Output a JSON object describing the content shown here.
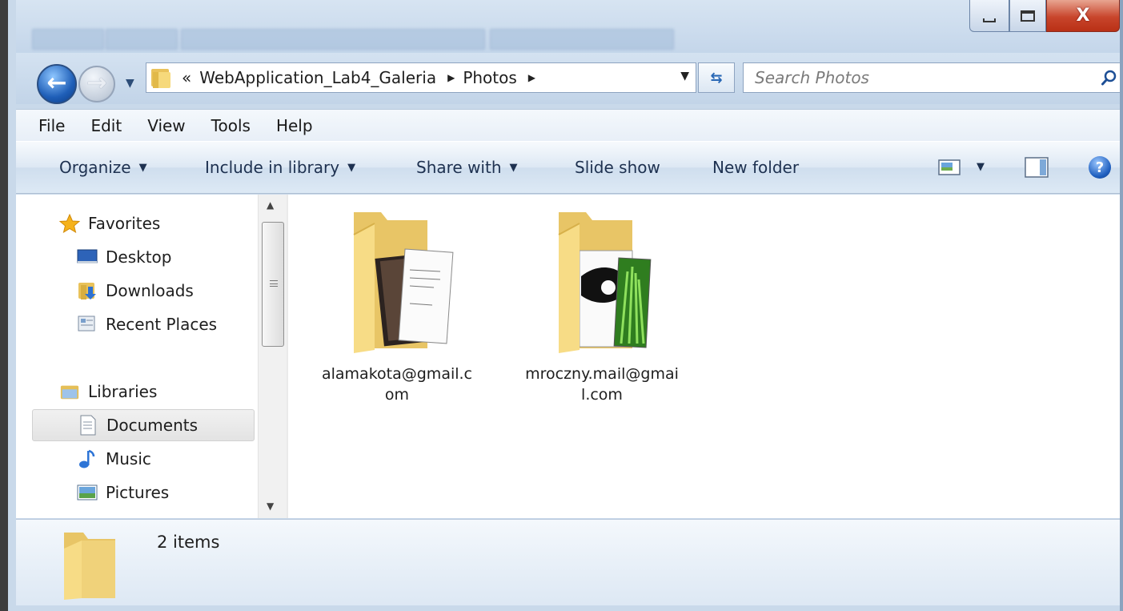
{
  "window": {
    "minimize_icon": "minimize-icon",
    "maximize_icon": "maximize-icon",
    "close_label": "X"
  },
  "nav": {
    "address_chevron": "«",
    "breadcrumbs": [
      "WebApplication_Lab4_Galeria",
      "Photos"
    ],
    "search_placeholder": "Search Photos"
  },
  "menu": [
    "File",
    "Edit",
    "View",
    "Tools",
    "Help"
  ],
  "toolbar": {
    "organize": "Organize",
    "include_in_library": "Include in library",
    "share_with": "Share with",
    "slide_show": "Slide show",
    "new_folder": "New folder",
    "help": "?"
  },
  "sidebar": {
    "favorites": {
      "label": "Favorites",
      "items": [
        "Desktop",
        "Downloads",
        "Recent Places"
      ]
    },
    "libraries": {
      "label": "Libraries",
      "items": [
        "Documents",
        "Music",
        "Pictures"
      ]
    },
    "selected": "Documents"
  },
  "files": [
    {
      "name": "alamakota@gmail.com",
      "icon": "folder-with-photo-icon"
    },
    {
      "name": "mroczny.mail@gmail.com",
      "icon": "folder-with-images-icon"
    }
  ],
  "details": {
    "count": "2 items"
  },
  "colors": {
    "frame": "#c9d9ea",
    "close_button": "#c8452c",
    "accent_blue": "#1f5fb8"
  }
}
